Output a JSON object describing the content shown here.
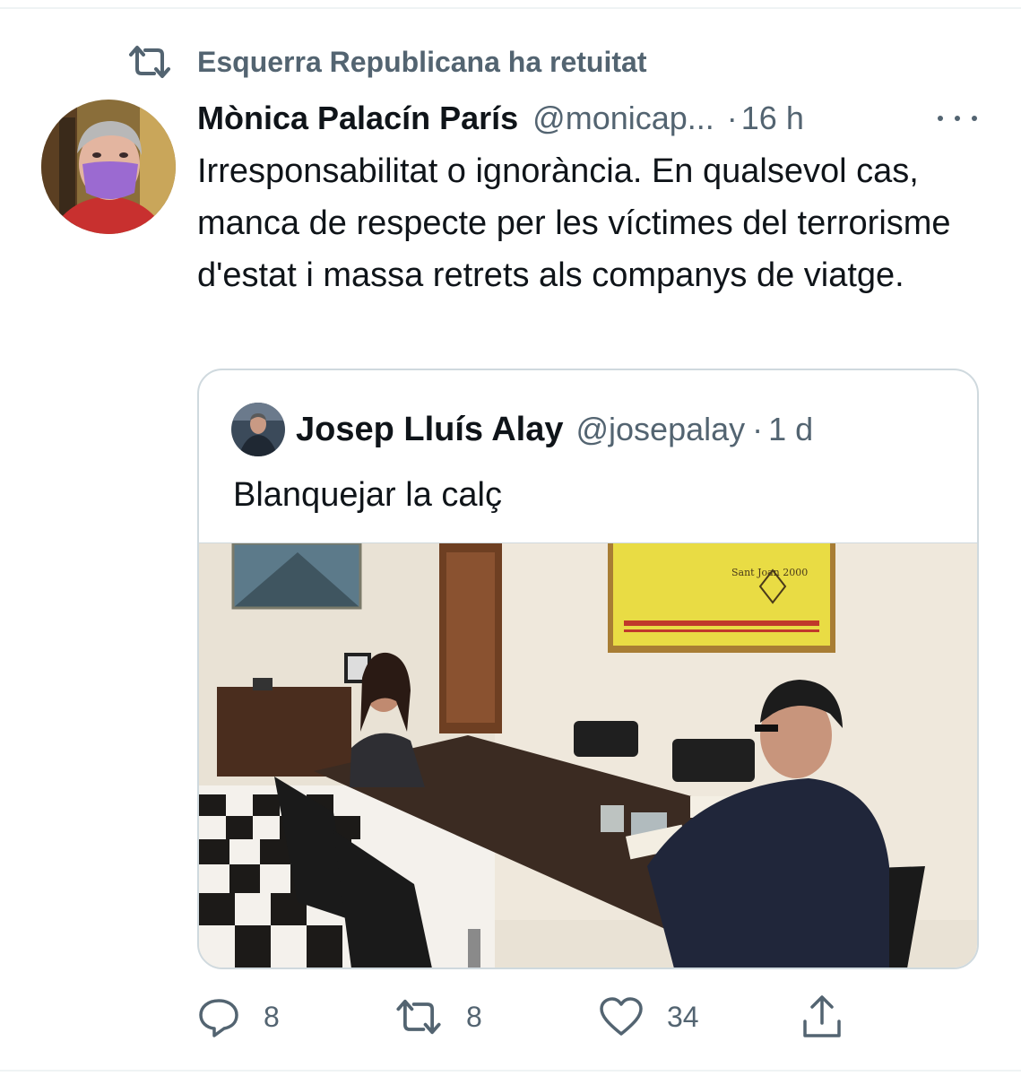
{
  "retweet_context": {
    "text": "Esquerra Republicana ha retuitat",
    "icon": "retweet-icon"
  },
  "tweet": {
    "author_name": "Mònica Palacín París",
    "author_handle": "@monicap...",
    "separator": "·",
    "time": "16 h",
    "text": "Irresponsabilitat o ignorància. En qualsevol cas, manca de respecte per les víctimes del terrorisme d'estat i massa retrets als companys de viatge."
  },
  "quoted_tweet": {
    "author_name": "Josep Lluís Alay",
    "author_handle": "@josepalay",
    "separator": "·",
    "time": "1 d",
    "text": "Blanquejar la calç",
    "artwork_text": "Sant Joan 2000"
  },
  "actions": {
    "replies": "8",
    "retweets": "8",
    "likes": "34"
  },
  "colors": {
    "text_primary": "#0f1419",
    "text_secondary": "#536471",
    "border": "#cfd9de"
  }
}
